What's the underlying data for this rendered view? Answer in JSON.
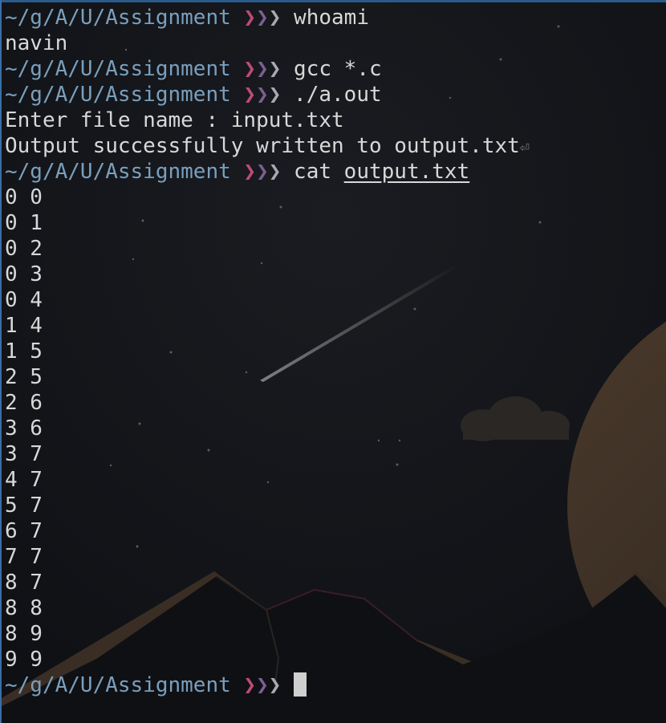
{
  "terminal": {
    "prompt_path": "~/g/A/U/Assignment",
    "prompt_arrows": [
      "❯",
      "❯",
      "❯"
    ],
    "lines": [
      {
        "type": "prompt",
        "command": "whoami"
      },
      {
        "type": "output",
        "text": "navin"
      },
      {
        "type": "prompt",
        "command": "gcc *.c"
      },
      {
        "type": "prompt",
        "command": "./a.out"
      },
      {
        "type": "output",
        "text": "Enter file name : input.txt"
      },
      {
        "type": "output",
        "text": "Output successfully written to output.txt",
        "eol_mark": "⏎"
      },
      {
        "type": "prompt",
        "command": "cat ",
        "arg": "output.txt"
      },
      {
        "type": "output",
        "text": "0 0"
      },
      {
        "type": "output",
        "text": "0 1"
      },
      {
        "type": "output",
        "text": "0 2"
      },
      {
        "type": "output",
        "text": "0 3"
      },
      {
        "type": "output",
        "text": "0 4"
      },
      {
        "type": "output",
        "text": "1 4"
      },
      {
        "type": "output",
        "text": "1 5"
      },
      {
        "type": "output",
        "text": "2 5"
      },
      {
        "type": "output",
        "text": "2 6"
      },
      {
        "type": "output",
        "text": "3 6"
      },
      {
        "type": "output",
        "text": "3 7"
      },
      {
        "type": "output",
        "text": "4 7"
      },
      {
        "type": "output",
        "text": "5 7"
      },
      {
        "type": "output",
        "text": "6 7"
      },
      {
        "type": "output",
        "text": "7 7"
      },
      {
        "type": "output",
        "text": "8 7"
      },
      {
        "type": "output",
        "text": "8 8"
      },
      {
        "type": "output",
        "text": "8 9"
      },
      {
        "type": "output",
        "text": "9 9"
      },
      {
        "type": "prompt",
        "command": "",
        "cursor": true
      }
    ]
  },
  "colors": {
    "path": "#7a9fbd",
    "arrow1": "#c04a78",
    "arrow2": "#7c5f93",
    "arrow3": "#a9a9b5",
    "text": "#d8d8d8",
    "window_border": "#3a6ea5"
  }
}
